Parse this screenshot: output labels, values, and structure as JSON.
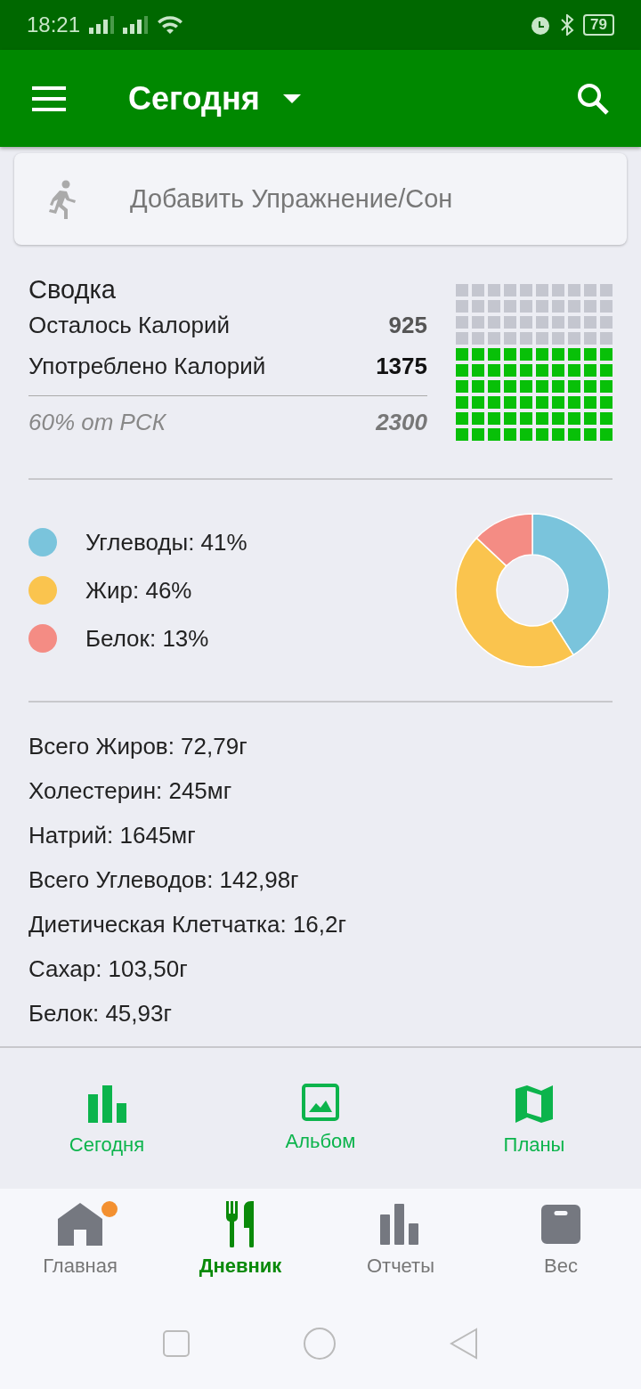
{
  "status_bar": {
    "time": "18:21",
    "battery": "79"
  },
  "app_bar": {
    "title": "Сегодня"
  },
  "add_card": {
    "label": "Добавить Упражнение/Сон"
  },
  "summary": {
    "title": "Сводка",
    "rows": [
      {
        "label": "Осталось Калорий",
        "value": "925",
        "bold": false
      },
      {
        "label": "Употреблено Калорий",
        "value": "1375",
        "bold": true
      }
    ],
    "footer_label": "60% от РСК",
    "footer_value": "2300"
  },
  "macros": {
    "items": [
      {
        "label": "Углеводы: 41%",
        "color": "#7ac4dc"
      },
      {
        "label": "Жир: 46%",
        "color": "#fac44e"
      },
      {
        "label": "Белок: 13%",
        "color": "#f48c84"
      }
    ],
    "chart_data": {
      "type": "donut",
      "values": [
        41,
        46,
        13
      ]
    }
  },
  "nutrients": [
    "Всего Жиров: 72,79г",
    "Холестерин: 245мг",
    "Натрий: 1645мг",
    "Всего Углеводов: 142,98г",
    "Диетическая Клетчатка: 16,2г",
    "Сахар: 103,50г",
    "Белок: 45,93г"
  ],
  "quick_links": [
    {
      "label": "Сегодня",
      "kind": "bars"
    },
    {
      "label": "Альбом",
      "kind": "image"
    },
    {
      "label": "Планы",
      "kind": "map"
    }
  ],
  "bottom_nav": [
    {
      "label": "Главная",
      "kind": "home",
      "selected": false,
      "badge": true
    },
    {
      "label": "Дневник",
      "kind": "diary",
      "selected": true,
      "badge": false
    },
    {
      "label": "Отчеты",
      "kind": "reports",
      "selected": false,
      "badge": false
    },
    {
      "label": "Вес",
      "kind": "scale",
      "selected": false,
      "badge": false
    }
  ]
}
